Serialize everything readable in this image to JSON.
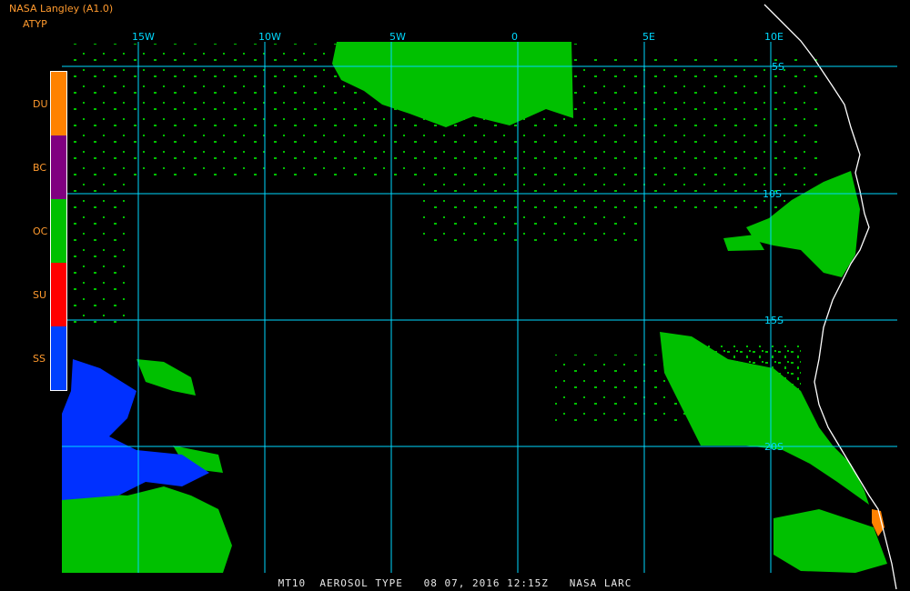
{
  "header": {
    "title": "NASA Langley (A1.0)",
    "product": "ATYP"
  },
  "legend": {
    "items": [
      {
        "code": "DU",
        "color": "#ff8200"
      },
      {
        "code": "BC",
        "color": "#800080"
      },
      {
        "code": "OC",
        "color": "#00c000"
      },
      {
        "code": "SU",
        "color": "#ff0000"
      },
      {
        "code": "SS",
        "color": "#0040ff"
      }
    ]
  },
  "grid": {
    "longitude_labels": [
      "15W",
      "10W",
      "5W",
      "0",
      "5E",
      "10E"
    ],
    "latitude_labels": [
      "5S",
      "10S",
      "15S",
      "20S"
    ],
    "line_color": "#00d9ff"
  },
  "colors": {
    "background": "#000000",
    "coastline": "#ffffff"
  },
  "footer": {
    "text": "MT10  AEROSOL TYPE   08 07, 2016 12:15Z   NASA LARC"
  }
}
